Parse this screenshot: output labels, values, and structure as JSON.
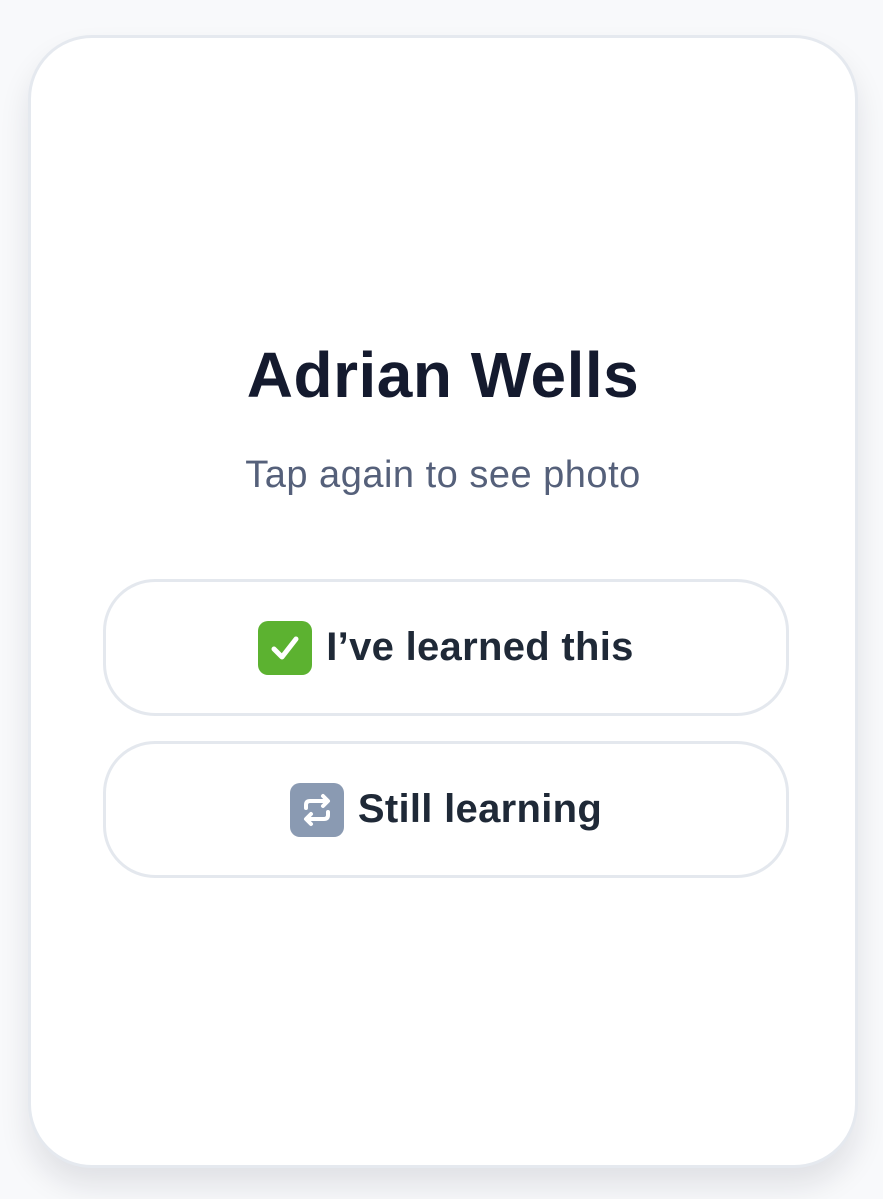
{
  "card": {
    "name": "Adrian Wells",
    "hint": "Tap again to see photo"
  },
  "actions": {
    "learned": {
      "label": "I’ve learned this",
      "icon": "check-mark-button-icon",
      "icon_color": "#5cb230"
    },
    "still_learning": {
      "label": "Still learning",
      "icon": "repeat-icon",
      "icon_color": "#8a9ab2"
    }
  },
  "colors": {
    "title": "#141a2e",
    "hint": "#55607a",
    "button_text": "#1f2937",
    "border": "#e4e8ee"
  }
}
